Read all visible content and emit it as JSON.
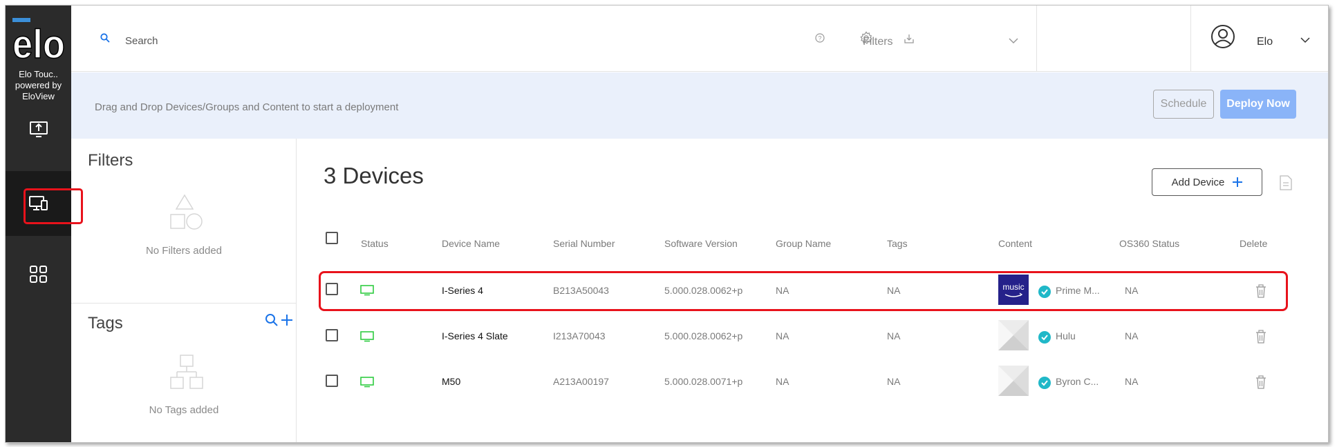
{
  "app": {
    "brand_name": "Elo Touc..",
    "brand_line2": "powered by",
    "brand_line3": "EloView",
    "logo_text": "elo"
  },
  "sidebar": {
    "items": [
      {
        "icon": "upload-screen-icon",
        "active": false
      },
      {
        "icon": "devices-icon",
        "active": true
      },
      {
        "icon": "apps-grid-icon",
        "active": false
      }
    ]
  },
  "header": {
    "search_placeholder": "Search",
    "filters_label": "Filters",
    "user_name": "Elo"
  },
  "deploy_bar": {
    "instruction": "Drag and Drop Devices/Groups and Content to start a deployment",
    "schedule_label": "Schedule",
    "deploy_label": "Deploy Now"
  },
  "filters_panel": {
    "title": "Filters",
    "empty_text": "No Filters added"
  },
  "tags_panel": {
    "title": "Tags",
    "empty_text": "No Tags added"
  },
  "devices": {
    "title": "3 Devices",
    "add_label": "Add Device",
    "columns": [
      "Status",
      "Device Name",
      "Serial Number",
      "Software Version",
      "Group Name",
      "Tags",
      "Content",
      "OS360 Status",
      "Delete"
    ],
    "rows": [
      {
        "status": "online",
        "name": "I-Series 4",
        "serial": "B213A50043",
        "software": "5.000.028.0062+p",
        "group": "NA",
        "tags": "NA",
        "content": "Prime M...",
        "content_thumb": "music",
        "os360": "NA"
      },
      {
        "status": "online",
        "name": "I-Series 4 Slate",
        "serial": "I213A70043",
        "software": "5.000.028.0062+p",
        "group": "NA",
        "tags": "NA",
        "content": "Hulu",
        "content_thumb": "placeholder",
        "os360": "NA"
      },
      {
        "status": "online",
        "name": "M50",
        "serial": "A213A00197",
        "software": "5.000.028.0071+p",
        "group": "NA",
        "tags": "NA",
        "content": "Byron C...",
        "content_thumb": "placeholder",
        "os360": "NA"
      }
    ]
  },
  "colors": {
    "sidebar_bg": "#2b2b2b",
    "accent_blue": "#1a73e8",
    "deploy_button": "#8ab4f8",
    "status_green": "#2ecc40",
    "check_teal": "#20b8c8",
    "highlight_red": "#e8121b"
  }
}
